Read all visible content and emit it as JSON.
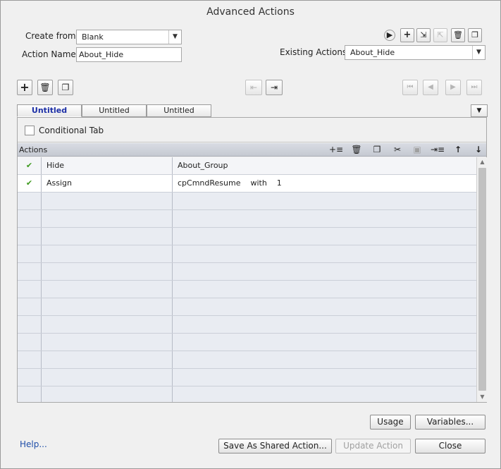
{
  "window": {
    "title": "Advanced Actions"
  },
  "form": {
    "create_from_label": "Create from:",
    "create_from_value": "Blank",
    "action_name_label": "Action Name:",
    "action_name_value": "About_Hide",
    "existing_actions_label": "Existing Actions:",
    "existing_actions_value": "About_Hide"
  },
  "top_icons": [
    "preview-icon",
    "add-icon",
    "import-icon",
    "export-icon",
    "delete-icon",
    "duplicate-icon"
  ],
  "tabs": [
    {
      "label": "Untitled",
      "active": true
    },
    {
      "label": "Untitled",
      "active": false
    },
    {
      "label": "Untitled",
      "active": false
    }
  ],
  "conditional": {
    "label": "Conditional Tab",
    "checked": false
  },
  "actions_bar": {
    "title": "Actions"
  },
  "grid": {
    "header": {
      "col2": "Hide",
      "col3": "About_Group"
    },
    "rows": [
      {
        "status": "✔",
        "action": "Assign",
        "target": "cpCmndResume    with    1"
      }
    ],
    "empty_rows": 12
  },
  "buttons": {
    "usage": "Usage",
    "variables": "Variables...",
    "save_shared": "Save As Shared Action...",
    "update": "Update Action",
    "close": "Close"
  },
  "help": {
    "label": "Help..."
  }
}
